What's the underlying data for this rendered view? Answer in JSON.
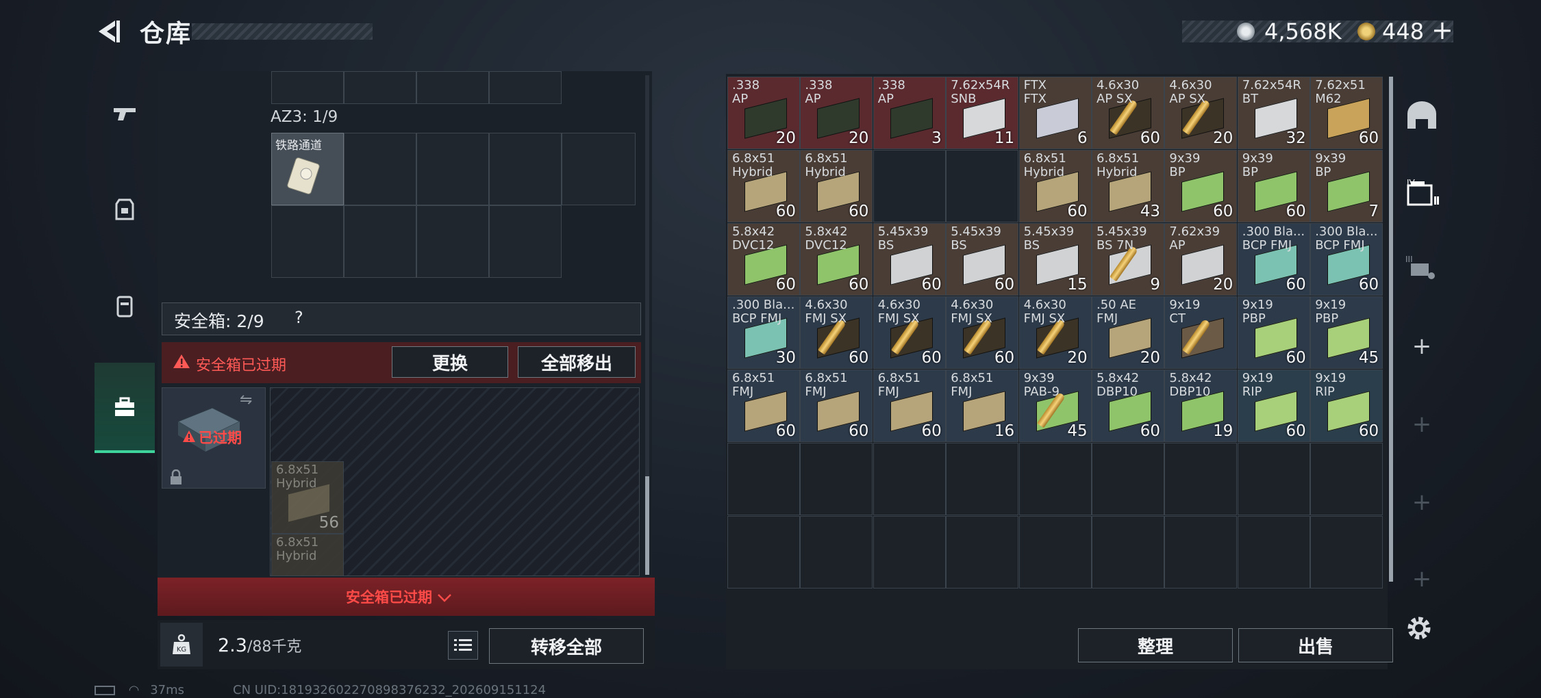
{
  "header": {
    "title": "仓库",
    "currency_silver": "4,568K",
    "currency_gold": "448",
    "plus": "+"
  },
  "left": {
    "az3_label": "AZ3: 1/9",
    "az3_item_name": "铁路通道",
    "safebox_label": "安全箱: 2/9",
    "safebox_help": "?",
    "expired_text": "安全箱已过期",
    "replace_btn": "更换",
    "move_all_out_btn": "全部移出",
    "case_expired": "已过期",
    "case_items": [
      {
        "name": "6.8x51\nHybrid",
        "qty": "56"
      },
      {
        "name": "6.8x51\nHybrid",
        "qty": ""
      }
    ],
    "footer_expired": "安全箱已过期",
    "weight_value": "2.3",
    "weight_unit": "/88千克",
    "transfer_all_btn": "转移全部"
  },
  "status": {
    "ping": "37ms",
    "uid": "CN UID:1819326022708983762​32_202609151124"
  },
  "inventory": {
    "sort_btn": "整理",
    "sell_btn": "出售",
    "slots": [
      {
        "name": ".338\nAP",
        "qty": "20",
        "color": "#5a2a2f",
        "box": "#2f3a2c"
      },
      {
        "name": ".338\nAP",
        "qty": "20",
        "color": "#5a2a2f",
        "box": "#2f3a2c"
      },
      {
        "name": ".338\nAP",
        "qty": "3",
        "color": "#5a2a2f",
        "box": "#2f3a2c"
      },
      {
        "name": "7.62x54R\nSNB",
        "qty": "11",
        "color": "#5a2a2f",
        "box": "#d6d8da"
      },
      {
        "name": "FTX\nFTX",
        "qty": "6",
        "color": "#4a3d36",
        "box": "#c9ccd6"
      },
      {
        "name": "4.6x30\nAP SX",
        "qty": "60",
        "color": "#4a3d36",
        "box": "#3b3326",
        "bullet": true
      },
      {
        "name": "4.6x30\nAP SX",
        "qty": "20",
        "color": "#4a3d36",
        "box": "#3b3326",
        "bullet": true
      },
      {
        "name": "7.62x54R\nBT",
        "qty": "32",
        "color": "#4a3d36",
        "box": "#d6d8da"
      },
      {
        "name": "7.62x51\nM62",
        "qty": "60",
        "color": "#4a3d36",
        "box": "#c9a35a"
      },
      {
        "name": "6.8x51\nHybrid",
        "qty": "60",
        "color": "#4a3d36",
        "box": "#b6a47a"
      },
      {
        "name": "6.8x51\nHybrid",
        "qty": "60",
        "color": "#4a3d36",
        "box": "#b6a47a"
      },
      {
        "name": "",
        "qty": "",
        "color": "#1e242c",
        "box": ""
      },
      {
        "name": "",
        "qty": "",
        "color": "#1e242c",
        "box": ""
      },
      {
        "name": "6.8x51\nHybrid",
        "qty": "60",
        "color": "#4a3d36",
        "box": "#b6a47a"
      },
      {
        "name": "6.8x51\nHybrid",
        "qty": "43",
        "color": "#4a3d36",
        "box": "#b6a47a"
      },
      {
        "name": "9x39\nBP",
        "qty": "60",
        "color": "#4a3d36",
        "box": "#8fc46a"
      },
      {
        "name": "9x39\nBP",
        "qty": "60",
        "color": "#4a3d36",
        "box": "#8fc46a"
      },
      {
        "name": "9x39\nBP",
        "qty": "7",
        "color": "#4a3d36",
        "box": "#8fc46a"
      },
      {
        "name": "5.8x42\nDVC12",
        "qty": "60",
        "color": "#4a3d36",
        "box": "#8fc46a"
      },
      {
        "name": "5.8x42\nDVC12",
        "qty": "60",
        "color": "#4a3d36",
        "box": "#8fc46a"
      },
      {
        "name": "5.45x39\nBS",
        "qty": "60",
        "color": "#4a3d36",
        "box": "#d0d2d4"
      },
      {
        "name": "5.45x39\nBS",
        "qty": "60",
        "color": "#4a3d36",
        "box": "#d0d2d4"
      },
      {
        "name": "5.45x39\nBS",
        "qty": "15",
        "color": "#4a3d36",
        "box": "#d0d2d4"
      },
      {
        "name": "5.45x39\nBS 7N",
        "qty": "9",
        "color": "#4a3d36",
        "box": "#d0d2d4",
        "bullet": true
      },
      {
        "name": "7.62x39\nAP",
        "qty": "20",
        "color": "#4a3d36",
        "box": "#d0d2d4"
      },
      {
        "name": ".300 Bla...\nBCP FMJ",
        "qty": "60",
        "color": "#2d3a4a",
        "box": "#7cc2b2"
      },
      {
        "name": ".300 Bla...\nBCP FMJ",
        "qty": "60",
        "color": "#2d3a4a",
        "box": "#7cc2b2"
      },
      {
        "name": ".300 Bla...\nBCP FMJ",
        "qty": "30",
        "color": "#2d3a4a",
        "box": "#7cc2b2"
      },
      {
        "name": "4.6x30\nFMJ SX",
        "qty": "60",
        "color": "#2d3a4a",
        "box": "#3b3326",
        "bullet": true
      },
      {
        "name": "4.6x30\nFMJ SX",
        "qty": "60",
        "color": "#2d3a4a",
        "box": "#3b3326",
        "bullet": true
      },
      {
        "name": "4.6x30\nFMJ SX",
        "qty": "60",
        "color": "#2d3a4a",
        "box": "#3b3326",
        "bullet": true
      },
      {
        "name": "4.6x30\nFMJ SX",
        "qty": "20",
        "color": "#2d3a4a",
        "box": "#3b3326",
        "bullet": true
      },
      {
        "name": ".50 AE\nFMJ",
        "qty": "20",
        "color": "#2d3a4a",
        "box": "#b6a47a"
      },
      {
        "name": "9x19\nCT",
        "qty": "",
        "color": "#2d3a4a",
        "box": "#6b5a46",
        "bullet": true
      },
      {
        "name": "9x19\nPBP",
        "qty": "60",
        "color": "#2d3a4a",
        "box": "#a8cf7a"
      },
      {
        "name": "9x19\nPBP",
        "qty": "45",
        "color": "#2d3a4a",
        "box": "#a8cf7a"
      },
      {
        "name": "6.8x51\nFMJ",
        "qty": "60",
        "color": "#2d3a4a",
        "box": "#b6a47a"
      },
      {
        "name": "6.8x51\nFMJ",
        "qty": "60",
        "color": "#2d3a4a",
        "box": "#b6a47a"
      },
      {
        "name": "6.8x51\nFMJ",
        "qty": "60",
        "color": "#2d3a4a",
        "box": "#b6a47a"
      },
      {
        "name": "6.8x51\nFMJ",
        "qty": "16",
        "color": "#2d3a4a",
        "box": "#b6a47a"
      },
      {
        "name": "9x39\nPAB-9",
        "qty": "45",
        "color": "#2d3a4a",
        "box": "#8fc46a",
        "bullet": true
      },
      {
        "name": "5.8x42\nDBP10",
        "qty": "60",
        "color": "#2d3a4a",
        "box": "#8fc46a"
      },
      {
        "name": "5.8x42\nDBP10",
        "qty": "19",
        "color": "#2d3a4a",
        "box": "#8fc46a"
      },
      {
        "name": "9x19\nRIP",
        "qty": "60",
        "color": "#2a3e4c",
        "box": "#a8cf7a"
      },
      {
        "name": "9x19\nRIP",
        "qty": "60",
        "color": "#2a3e4c",
        "box": "#a8cf7a"
      }
    ]
  }
}
